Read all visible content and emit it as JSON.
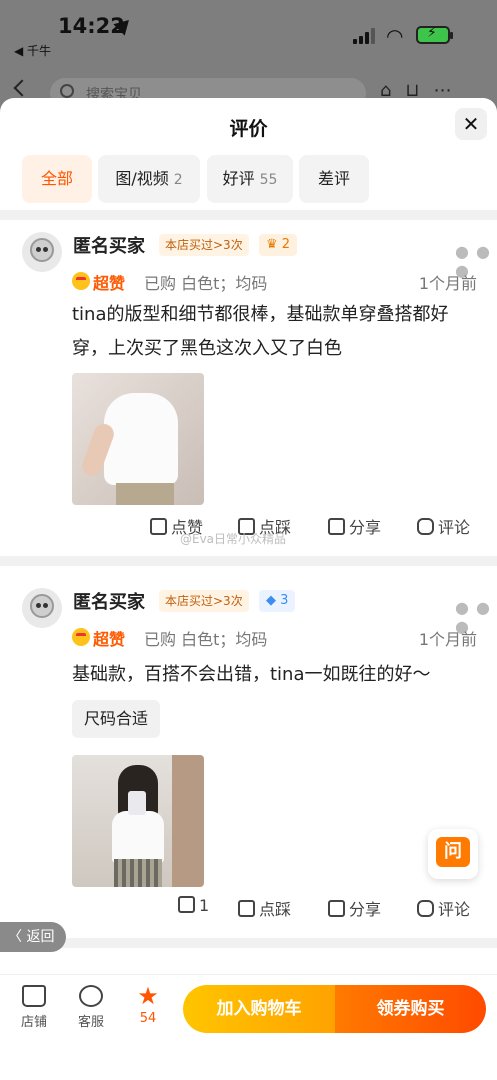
{
  "status_bar": {
    "time": "14:22",
    "back_app": "◀ 千牛"
  },
  "background": {
    "search_placeholder": "搜索宝贝"
  },
  "sheet": {
    "title": "评价",
    "close": "✕"
  },
  "filters": [
    {
      "label": "全部",
      "count": ""
    },
    {
      "label": "图/视频",
      "count": "2"
    },
    {
      "label": "好评",
      "count": "55"
    },
    {
      "label": "差评",
      "count": ""
    }
  ],
  "reviews": [
    {
      "user": "匿名买家",
      "repeat_badge": "本店买过>3次",
      "level_icon": "crown-icon",
      "level": "♛ 2",
      "rating": "超赞",
      "purchase": "已购 白色t；均码",
      "time": "1个月前",
      "content": "tina的版型和细节都很棒，基础款单穿叠搭都好穿，上次买了黑色这次入又了白色",
      "tag": "",
      "actions": {
        "like": "点赞",
        "dislike": "点踩",
        "share": "分享",
        "comment": "评论"
      }
    },
    {
      "user": "匿名买家",
      "repeat_badge": "本店买过>3次",
      "level_icon": "diamond-icon",
      "level": "◆ 3",
      "rating": "超赞",
      "purchase": "已购 白色t；均码",
      "time": "1个月前",
      "content": "基础款，百搭不会出错，tina一如既往的好～",
      "tag": "尺码合适",
      "actions": {
        "like": "1",
        "dislike": "点踩",
        "share": "分享",
        "comment": "评论"
      }
    }
  ],
  "watermark": "@Eva日常小众精品",
  "float": {
    "ask": "问",
    "back": "〈 返回"
  },
  "bottom_bar": {
    "shop": "店铺",
    "service": "客服",
    "favorites": "54",
    "add_to_cart": "加入购物车",
    "buy": "领券购买"
  },
  "colors": {
    "accent": "#ff5500",
    "cart": "#ffb000",
    "buy": "#ff5a00"
  }
}
